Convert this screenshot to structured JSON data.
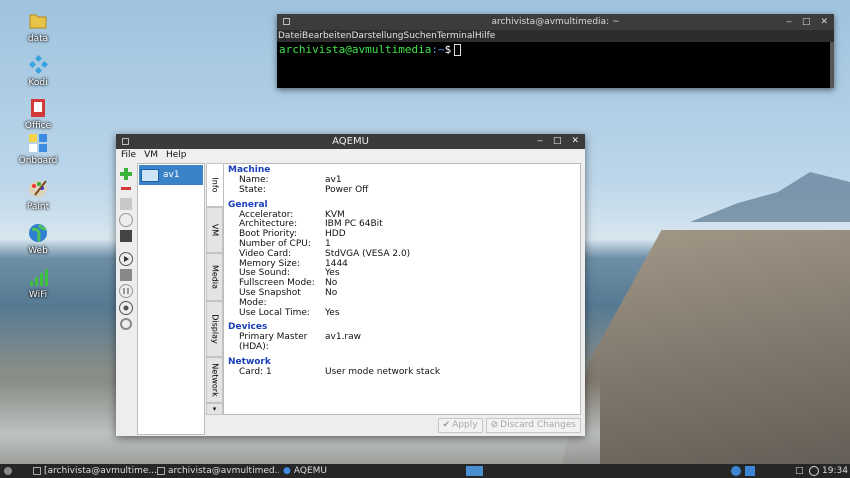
{
  "desktop": {
    "icons": [
      {
        "label": "data",
        "icon": "folder-icon"
      },
      {
        "label": "Kodi",
        "icon": "kodi-icon"
      },
      {
        "label": "Office",
        "icon": "office-icon"
      },
      {
        "label": "Onboard",
        "icon": "keyboard-icon"
      },
      {
        "label": "Paint",
        "icon": "palette-icon"
      },
      {
        "label": "Web",
        "icon": "globe-icon"
      },
      {
        "label": "WiFi",
        "icon": "wifi-icon"
      }
    ]
  },
  "terminal": {
    "title": "archivista@avmultimedia: ~",
    "menu": [
      "Datei",
      "Bearbeiten",
      "Darstellung",
      "Suchen",
      "Terminal",
      "Hilfe"
    ],
    "prompt_user": "archivista@avmultimedia",
    "prompt_path": ":~",
    "prompt_symbol": "$"
  },
  "aqemu": {
    "title": "AQEMU",
    "menu": [
      "File",
      "VM",
      "Help"
    ],
    "vm_list": [
      {
        "name": "av1"
      }
    ],
    "tabs": [
      "Info",
      "VM",
      "Media",
      "Display",
      "Network"
    ],
    "sections": [
      {
        "title": "Machine",
        "rows": [
          [
            "Name:",
            "av1"
          ],
          [
            "State:",
            "Power Off"
          ]
        ]
      },
      {
        "title": "General",
        "rows": [
          [
            "Accelerator:",
            "KVM"
          ],
          [
            "Architecture:",
            "IBM PC 64Bit"
          ],
          [
            "Boot Priority:",
            "HDD"
          ],
          [
            "Number of CPU:",
            "1"
          ],
          [
            "Video Card:",
            "StdVGA (VESA 2.0)"
          ],
          [
            "Memory Size:",
            "1444"
          ],
          [
            "Use Sound:",
            "Yes"
          ],
          [
            "Fullscreen Mode:",
            "No"
          ],
          [
            "Use Snapshot Mode:",
            "No"
          ],
          [
            "Use Local Time:",
            "Yes"
          ]
        ]
      },
      {
        "title": "Devices",
        "rows": [
          [
            "Primary Master (HDA):",
            "av1.raw"
          ]
        ]
      },
      {
        "title": "Network",
        "rows": [
          [
            "Card: 1",
            "User mode network stack"
          ]
        ]
      }
    ],
    "buttons": {
      "apply": "Apply",
      "discard": "Discard Changes"
    }
  },
  "taskbar": {
    "tasks": [
      "[archivista@avmultime...",
      "archivista@avmultimed...",
      "AQEMU"
    ],
    "clock": "19:34"
  },
  "colors": {
    "section_title": "#1a3fb8",
    "selection": "#3a83c8",
    "prompt_user": "#3ee24b",
    "prompt_path": "#4d8cf0"
  }
}
